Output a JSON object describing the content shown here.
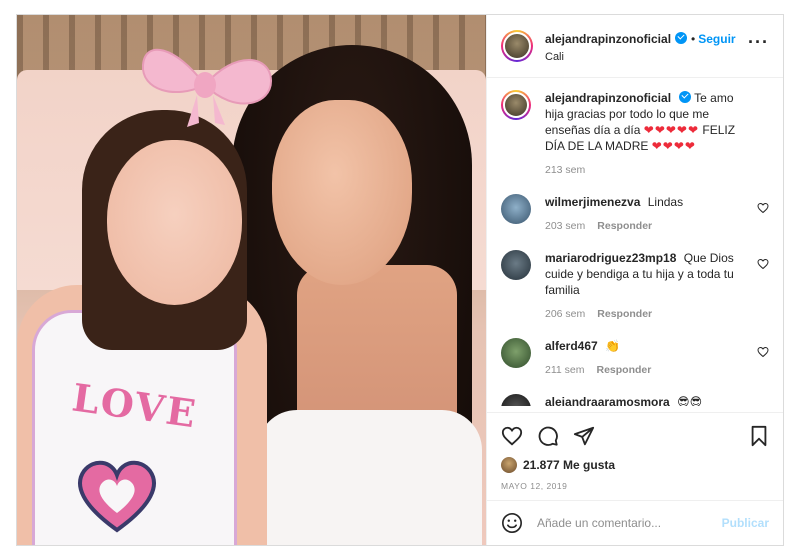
{
  "header": {
    "username": "alejandrapinzonoficial",
    "separator": "•",
    "follow_label": "Seguir",
    "location": "Cali",
    "more_icon": "more-options-icon"
  },
  "caption": {
    "username": "alejandrapinzonoficial",
    "text": "Te amo hija gracias por todo lo que me enseñas día a día",
    "hearts": "❤❤❤❤❤",
    "text2": "FELIZ DÍA DE LA MADRE",
    "hearts2": "❤❤❤❤",
    "age": "213 sem"
  },
  "comments": [
    {
      "username": "wilmerjimenezva",
      "text": "Lindas",
      "age": "203 sem",
      "reply": "Responder"
    },
    {
      "username": "mariarodriguez23mp18",
      "text": "Que Dios cuide y bendiga a tu hija y a toda tu familia",
      "age": "206 sem",
      "reply": "Responder"
    },
    {
      "username": "alferd467",
      "text": "👏",
      "age": "211 sem",
      "reply": "Responder"
    },
    {
      "username": "alejandraaramosmora",
      "text": "😎😎"
    }
  ],
  "photo": {
    "shirt_text": "LOVE"
  },
  "actions": {
    "likes_count": "21.877",
    "likes_label": "Me gusta",
    "date": "MAYO 12, 2019"
  },
  "compose": {
    "placeholder": "Añade un comentario...",
    "publish_label": "Publicar"
  },
  "colors": {
    "accent": "#0095f6",
    "heart": "#ed2b3a",
    "publish_disabled": "#b2dffc"
  }
}
